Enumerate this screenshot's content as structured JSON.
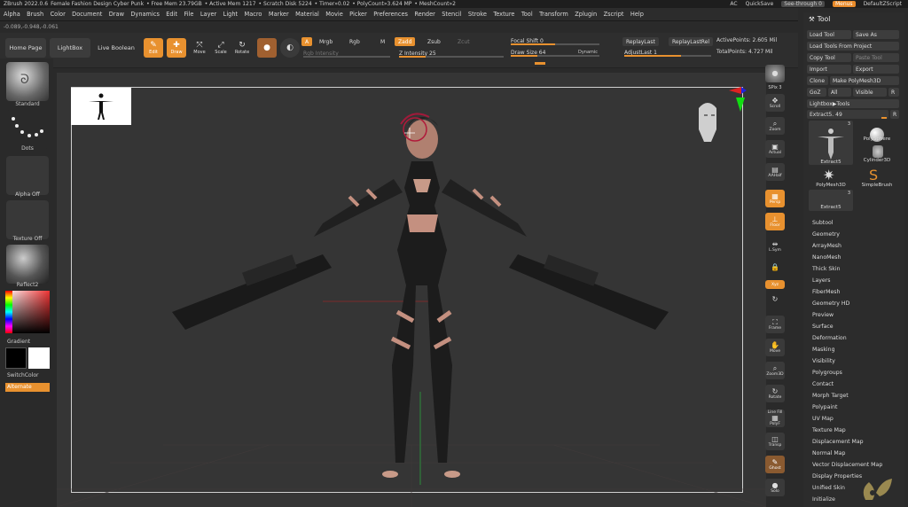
{
  "titlebar": {
    "app": "ZBrush 2022.0.6",
    "doc": "Female Fashion Design Cyber Punk",
    "free_mem": "• Free Mem 23.79GB",
    "active_mem": "• Active Mem 1217",
    "scratch": "• Scratch Disk 5224",
    "timer": "• Timer»0.02",
    "polycount": "• PolyCount»3.624 MP",
    "meshcount": "• MeshCount»2",
    "ac": "AC",
    "quicksave": "QuickSave",
    "seethrough": "See-through  0",
    "menus": "Menus",
    "script": "DefaultZScript"
  },
  "menubar": [
    "Alpha",
    "Brush",
    "Color",
    "Document",
    "Draw",
    "Dynamics",
    "Edit",
    "File",
    "Layer",
    "Light",
    "Macro",
    "Marker",
    "Material",
    "Movie",
    "Picker",
    "Preferences",
    "Render",
    "Stencil",
    "Stroke",
    "Texture",
    "Tool",
    "Transform",
    "Zplugin",
    "Zscript",
    "Help"
  ],
  "coords": "-0.089,-0.948,-0.061",
  "shelf": {
    "home": "Home Page",
    "lightbox": "LightBox",
    "liveboolean": "Live Boolean",
    "edit": "Edit",
    "draw": "Draw",
    "move": "Move",
    "scale": "Scale",
    "rotate": "Rotate",
    "a": "A",
    "mrgb": "Mrgb",
    "rgb": "Rgb",
    "m": "M",
    "zadd": "Zadd",
    "zsub": "Zsub",
    "zcut": "Zcut",
    "rgb_intensity": "Rgb Intensity",
    "z_intensity": "Z Intensity 25",
    "focal_shift": "Focal Shift 0",
    "draw_size": "Draw Size 64",
    "dynamic": "Dynamic",
    "replaylast": "ReplayLast",
    "replaylastrel": "ReplayLastRel",
    "adjustlast": "AdjustLast 1",
    "active_points": "ActivePoints: 2.605 Mil",
    "total_points": "TotalPoints: 4.727 Mil"
  },
  "leftpanel": {
    "standard": "Standard",
    "dots": "Dots",
    "alpha_off": "Alpha Off",
    "texture_off": "Texture Off",
    "reflect": "Reflect2",
    "gradient": "Gradient",
    "switchcolor": "SwitchColor",
    "alternate": "Alternate"
  },
  "rightbar": {
    "spix": "SPix 3",
    "scroll": "Scroll",
    "zoom": "Zoom",
    "actual": "Actual",
    "aahalf": "AAHalf",
    "persp": "Persp",
    "floor": "Floor",
    "lsym": "L.Sym",
    "xyz": "Xyz",
    "frame": "Frame",
    "move": "Move",
    "zoom3d": "Zoom3D",
    "rotate": "Rotate",
    "linefill": "Line Fill",
    "polyf": "PolyF",
    "transp": "Transp",
    "ghost": "Ghost",
    "solo": "Solo"
  },
  "toolpanel": {
    "title": "Tool",
    "load_tool": "Load Tool",
    "save_as": "Save As",
    "load_from_project": "Load Tools From Project",
    "copy_tool": "Copy Tool",
    "paste_tool": "Paste Tool",
    "import": "Import",
    "export": "Export",
    "clone": "Clone",
    "make_polymesh": "Make PolyMesh3D",
    "goz": "GoZ",
    "all": "All",
    "visible": "Visible",
    "r": "R",
    "lightbox_tools": "Lightbox▶Tools",
    "extract_slider": "Extract5. 49",
    "thumbs": {
      "extract5": "Extract5",
      "polysphere": "PolySphere",
      "cylinder3d": "Cylinder3D",
      "polymesh3d": "PolyMesh3D",
      "simplebrush": "SimpleBrush",
      "extract5b": "Extract5",
      "count": "3"
    },
    "sections": [
      "Subtool",
      "Geometry",
      "ArrayMesh",
      "NanoMesh",
      "Thick Skin",
      "Layers",
      "FiberMesh",
      "Geometry HD",
      "Preview",
      "Surface",
      "Deformation",
      "Masking",
      "Visibility",
      "Polygroups",
      "Contact",
      "Morph Target",
      "Polypaint",
      "UV Map",
      "Texture Map",
      "Displacement Map",
      "Normal Map",
      "Vector Displacement Map",
      "Display Properties",
      "Unified Skin",
      "Initialize"
    ]
  },
  "colors": {
    "accent": "#e8912f",
    "panel": "#2c2c2c",
    "viewport": "#353535"
  }
}
